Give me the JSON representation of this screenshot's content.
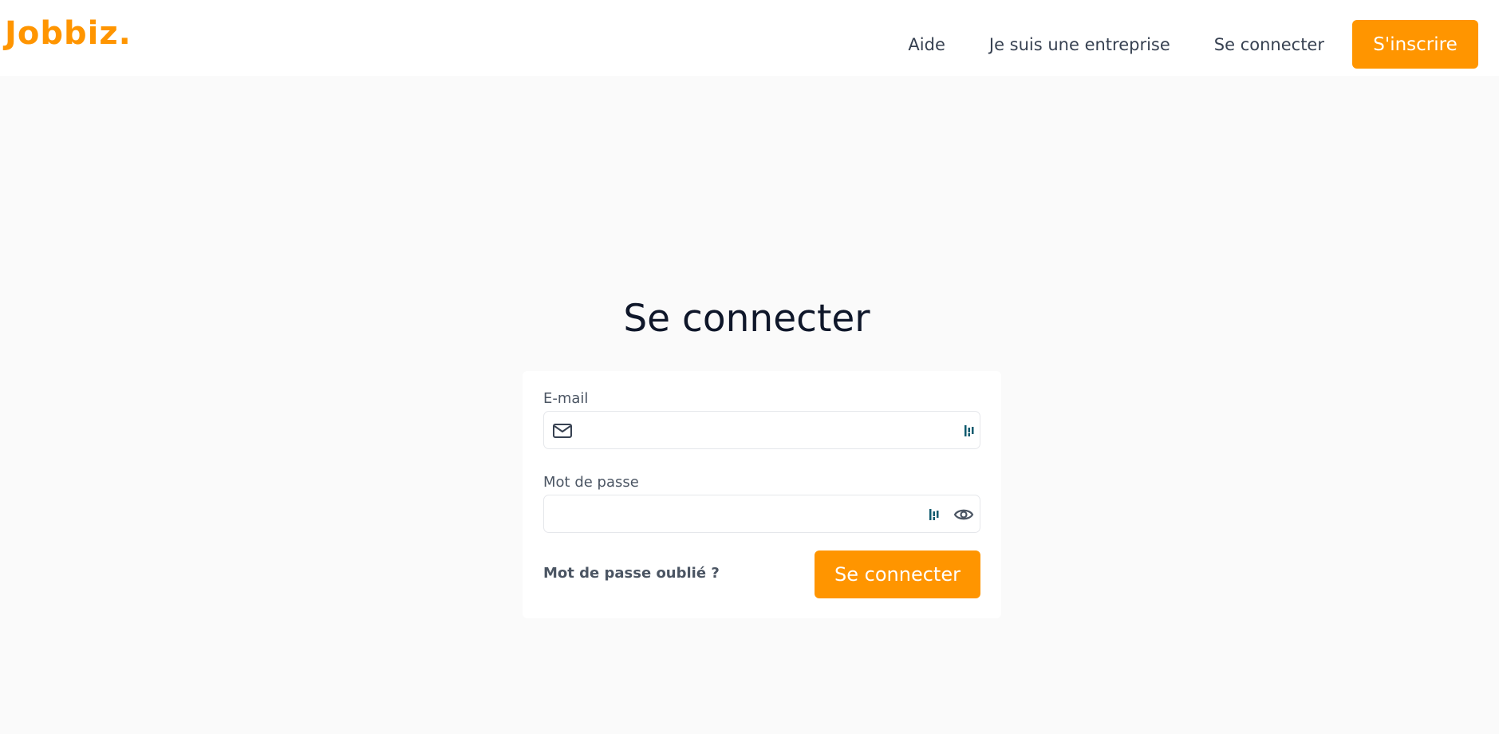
{
  "header": {
    "logo_text": "Jobbiz.",
    "nav": {
      "help_label": "Aide",
      "company_label": "Je suis une entreprise",
      "login_label": "Se connecter",
      "signup_label": "S'inscrire"
    }
  },
  "login": {
    "title": "Se connecter",
    "email_label": "E-mail",
    "email_value": "",
    "password_label": "Mot de passe",
    "password_value": "",
    "forgot_label": "Mot de passe oublié ?",
    "submit_label": "Se connecter"
  },
  "colors": {
    "accent": "#ff9500",
    "background": "#fafafa",
    "password_manager_icon": "#0f5a6e"
  },
  "icons": [
    "mail-icon",
    "password-manager-icon",
    "eye-icon"
  ]
}
